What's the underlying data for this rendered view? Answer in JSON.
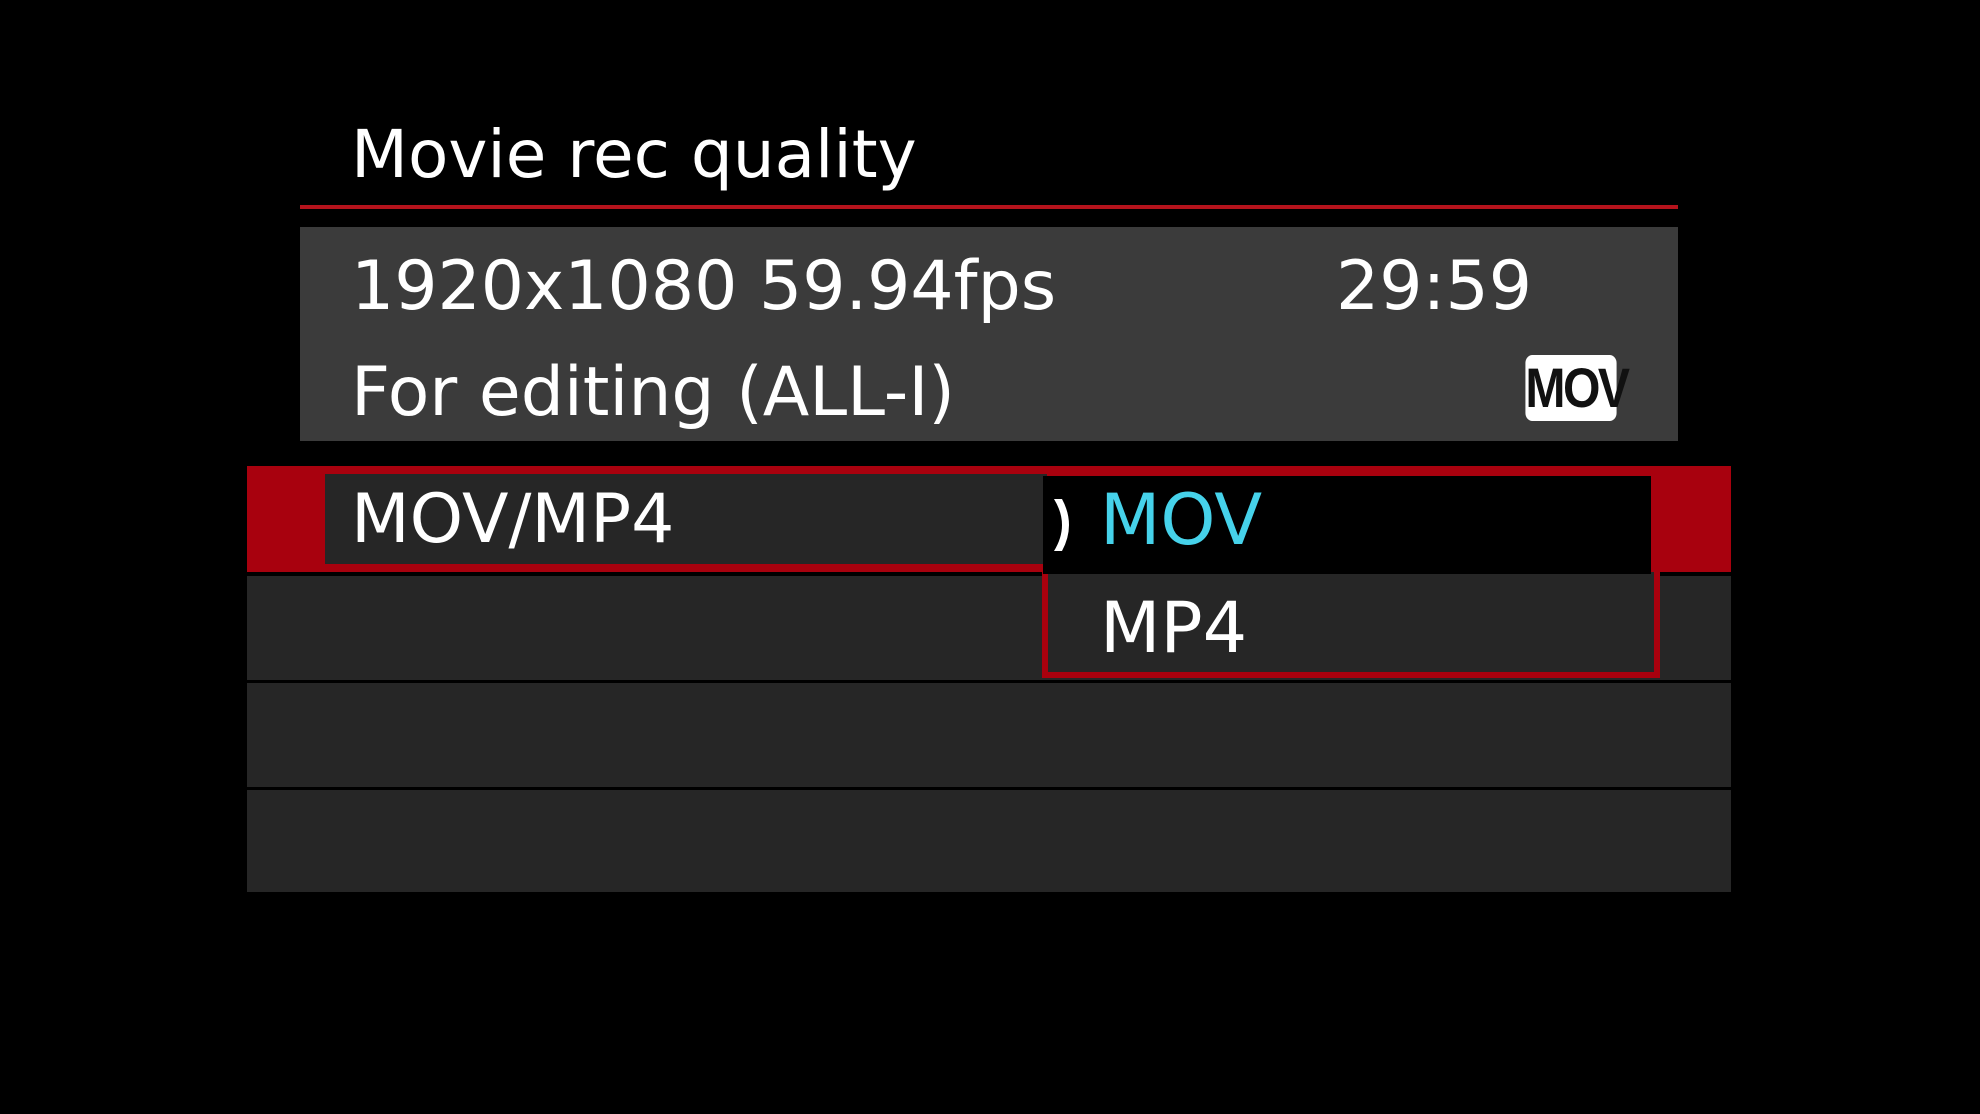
{
  "screen": {
    "title": "Movie rec quality"
  },
  "info": {
    "resolution_fps": "1920x1080 59.94fps",
    "rec_time": "29:59",
    "compression": "For editing (ALL-I)",
    "format_badge": "MOV"
  },
  "menu": {
    "items": [
      {
        "label": "MOV/MP4",
        "selected": true
      },
      {
        "label": ""
      },
      {
        "label": ""
      },
      {
        "label": ""
      }
    ]
  },
  "dropdown": {
    "options": [
      {
        "label": "MOV",
        "selected": true
      },
      {
        "label": "MP4",
        "selected": false
      }
    ]
  },
  "colors": {
    "accent_red": "#a8010e",
    "selected_text": "#46d2ea",
    "panel_gray": "#3b3b3b",
    "row_gray": "#262626"
  },
  "icons": {
    "selection_caret": "caret-right-icon"
  }
}
